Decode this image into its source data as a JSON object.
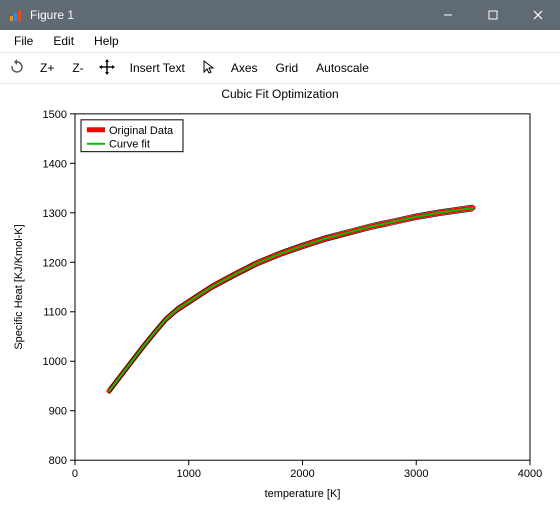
{
  "window": {
    "title": "Figure 1"
  },
  "menubar": {
    "items": [
      "File",
      "Edit",
      "Help"
    ]
  },
  "toolbar": {
    "rotate_name": "rotate-icon",
    "zoom_in": "Z+",
    "zoom_out": "Z-",
    "move_name": "pan-icon",
    "insert_text": "Insert Text",
    "cursor_name": "cursor-icon",
    "axes": "Axes",
    "grid": "Grid",
    "autoscale": "Autoscale"
  },
  "chart_data": {
    "type": "line",
    "title": "Cubic Fit Optimization",
    "xlabel": "temperature [K]",
    "ylabel": "Specific Heat [KJ/Kmol-K]",
    "xlim": [
      0,
      4000
    ],
    "ylim": [
      800,
      1500
    ],
    "xticks": [
      0,
      1000,
      2000,
      3000,
      4000
    ],
    "yticks": [
      800,
      900,
      1000,
      1100,
      1200,
      1300,
      1400,
      1500
    ],
    "legend": {
      "position": "upper-left",
      "items": [
        "Original Data",
        "Curve fit"
      ]
    },
    "series": [
      {
        "name": "Original Data",
        "color": "#ff0000",
        "linewidth": 5,
        "x": [
          300,
          400,
          500,
          600,
          700,
          800,
          900,
          1000,
          1200,
          1400,
          1600,
          1800,
          2000,
          2200,
          2400,
          2600,
          2800,
          3000,
          3200,
          3500
        ],
        "y": [
          940,
          970,
          1000,
          1030,
          1058,
          1085,
          1105,
          1120,
          1150,
          1175,
          1198,
          1217,
          1233,
          1248,
          1260,
          1272,
          1282,
          1292,
          1300,
          1310
        ]
      },
      {
        "name": "Curve fit",
        "color": "#00c000",
        "linewidth": 2,
        "x": [
          300,
          400,
          500,
          600,
          700,
          800,
          900,
          1000,
          1200,
          1400,
          1600,
          1800,
          2000,
          2200,
          2400,
          2600,
          2800,
          3000,
          3200,
          3500
        ],
        "y": [
          940,
          970,
          1000,
          1030,
          1058,
          1085,
          1105,
          1120,
          1150,
          1175,
          1198,
          1217,
          1233,
          1248,
          1260,
          1272,
          1282,
          1292,
          1300,
          1310
        ]
      }
    ]
  }
}
